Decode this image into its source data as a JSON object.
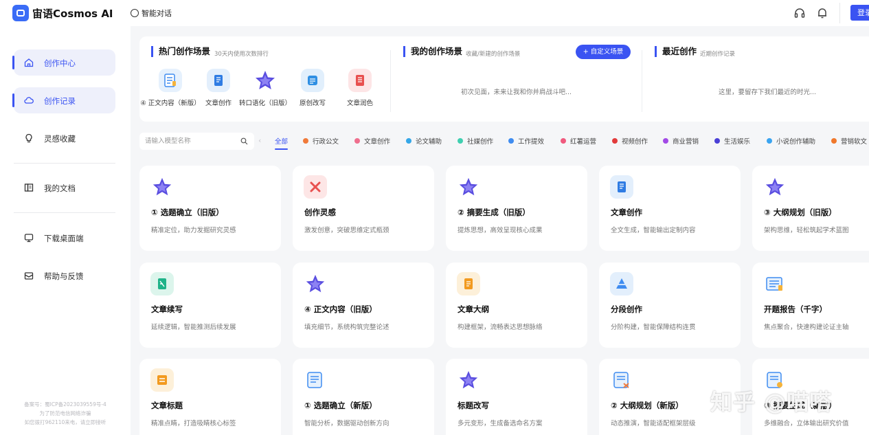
{
  "header": {
    "app_name": "宙语Cosmos AI",
    "chat_link": "智能对话",
    "login_label": "登录",
    "icons": [
      "headset-icon",
      "bell-icon"
    ],
    "accent_color": "#3a53f2"
  },
  "sidebar": {
    "items": [
      {
        "label": "创作中心",
        "icon": "home-icon",
        "active": true
      },
      {
        "label": "创作记录",
        "icon": "cloud-icon",
        "active": true
      },
      {
        "label": "灵感收藏",
        "icon": "lightbulb-icon",
        "active": false
      },
      {
        "label": "我的文档",
        "icon": "book-icon",
        "active": false
      },
      {
        "label": "下载桌面端",
        "icon": "monitor-icon",
        "active": false
      },
      {
        "label": "帮助与反馈",
        "icon": "mail-icon",
        "active": false
      }
    ],
    "footer_lines": [
      "备案号：蜀ICP备2023039559号-4",
      "为了防范电信网络诈骗",
      "如您拨打962110来电，请立即接听"
    ]
  },
  "hot_scenes": {
    "title": "热门创作场景",
    "subtitle": "30天内使用次数排行",
    "items": [
      {
        "label": "④ 正文内容（新版）"
      },
      {
        "label": "文章创作"
      },
      {
        "label": "转口语化（旧版）"
      },
      {
        "label": "原创改写"
      },
      {
        "label": "文章润色"
      }
    ]
  },
  "my_scenes": {
    "title": "我的创作场景",
    "subtitle": "收藏/新建的创作场景",
    "button": "+ 自定义场景",
    "empty": "初次见面，未来让我和你并肩战斗吧..."
  },
  "recent": {
    "title": "最近创作",
    "subtitle": "近期创作记录",
    "empty": "这里，要留存下我们最近的时光..."
  },
  "filters": {
    "search_placeholder": "请输入模型名称",
    "categories": [
      {
        "label": "全部",
        "color": "",
        "active": true
      },
      {
        "label": "行政公文",
        "color": "#f07a3a"
      },
      {
        "label": "文章创作",
        "color": "#ef6f8e"
      },
      {
        "label": "论文辅助",
        "color": "#35a7e8"
      },
      {
        "label": "社媒创作",
        "color": "#3fcfb0"
      },
      {
        "label": "工作提效",
        "color": "#3f8cf0"
      },
      {
        "label": "红薯运营",
        "color": "#f05a7e"
      },
      {
        "label": "视频创作",
        "color": "#e23b3b"
      },
      {
        "label": "商业营销",
        "color": "#a24ae6"
      },
      {
        "label": "生活娱乐",
        "color": "#4a3fd6"
      },
      {
        "label": "小说创作辅助",
        "color": "#3aa4f0"
      },
      {
        "label": "营销软文",
        "color": "#f0782c"
      }
    ]
  },
  "cards": [
    {
      "title": "① 选题确立（旧版）",
      "desc": "精准定位，助力发掘研究灵感",
      "icon": "star-icon"
    },
    {
      "title": "创作灵感",
      "desc": "激发创意，突破思维定式瓶颈",
      "icon": "cross-tools-icon"
    },
    {
      "title": "② 摘要生成（旧版）",
      "desc": "提炼思想，高效呈现核心成果",
      "icon": "star-icon"
    },
    {
      "title": "文章创作",
      "desc": "全文生成，智能输出定制内容",
      "icon": "notebook-icon"
    },
    {
      "title": "③ 大纲规划（旧版）",
      "desc": "架构思维，轻松筑起学术蓝图",
      "icon": "star-icon"
    },
    {
      "title": "文章续写",
      "desc": "延续逻辑，智能推测后续发展",
      "icon": "doc-green-icon"
    },
    {
      "title": "④ 正文内容（旧版）",
      "desc": "填充细节，系统构筑完整论述",
      "icon": "star-icon"
    },
    {
      "title": "文章大纲",
      "desc": "构建框架，流畅表达思想脉络",
      "icon": "outline-icon"
    },
    {
      "title": "分段创作",
      "desc": "分阶构建，智能保障结构连贯",
      "icon": "pyramid-icon"
    },
    {
      "title": "开题报告（千字）",
      "desc": "焦点聚合，快速构建论证主轴",
      "icon": "report-icon"
    },
    {
      "title": "文章标题",
      "desc": "精准点睛，打造吸睛核心标签",
      "icon": "title-icon"
    },
    {
      "title": "① 选题确立（新版）",
      "desc": "智能分析，数据驱动创新方向",
      "icon": "checklist-icon"
    },
    {
      "title": "标题改写",
      "desc": "多元变形，生成备选命名方案",
      "icon": "star-icon"
    },
    {
      "title": "② 大纲规划（新版）",
      "desc": "动态推演，智能适配框架层级",
      "icon": "plan-icon"
    },
    {
      "title": "③ 摘要生成（新版）",
      "desc": "多维融合，立体输出研究价值",
      "icon": "summary-icon"
    }
  ],
  "watermark": "知乎 @喵嗒"
}
